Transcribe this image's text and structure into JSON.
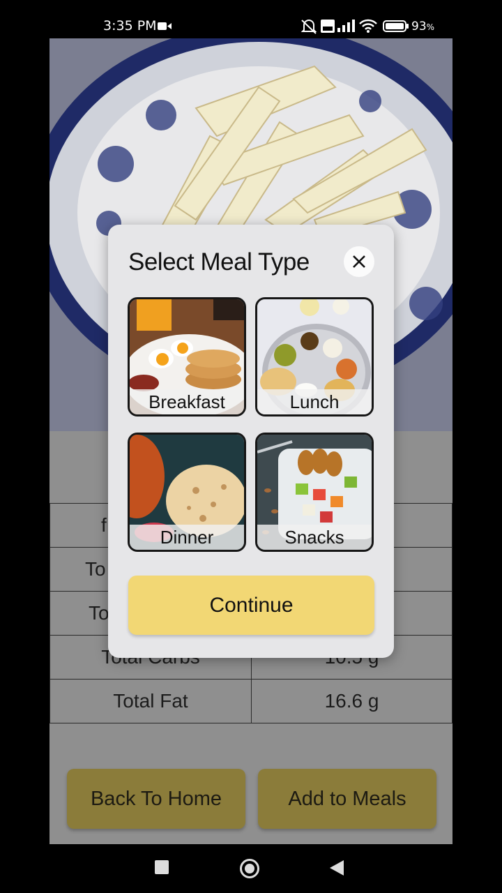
{
  "status_bar": {
    "time": "3:35 PM",
    "battery_pct": "93",
    "battery_suffix": "%",
    "icons": [
      "video-camera-icon",
      "bell-off-icon",
      "volte-icon",
      "signal-icon",
      "wifi-icon",
      "battery-icon"
    ]
  },
  "background": {
    "nutrition_rows": [
      {
        "label": "f",
        "value": ""
      },
      {
        "label": "To",
        "value": ""
      },
      {
        "label": "To",
        "value": ""
      },
      {
        "label": "Total Carbs",
        "value": "10.5 g"
      },
      {
        "label": "Total Fat",
        "value": "16.6 g"
      }
    ],
    "back_button_label": "Back To Home",
    "add_button_label": "Add to Meals"
  },
  "modal": {
    "title": "Select Meal Type",
    "close_icon": "close-icon",
    "meal_types": [
      {
        "label": "Breakfast"
      },
      {
        "label": "Lunch"
      },
      {
        "label": "Dinner"
      },
      {
        "label": "Snacks"
      }
    ],
    "continue_label": "Continue"
  },
  "colors": {
    "modal_bg": "#e6e6e8",
    "continue_bg": "#f2d774",
    "dimmed_button_bg": "#8b7c3a"
  },
  "nav_bar": {
    "icons": [
      "recents-square-icon",
      "home-circle-icon",
      "back-triangle-icon"
    ]
  }
}
